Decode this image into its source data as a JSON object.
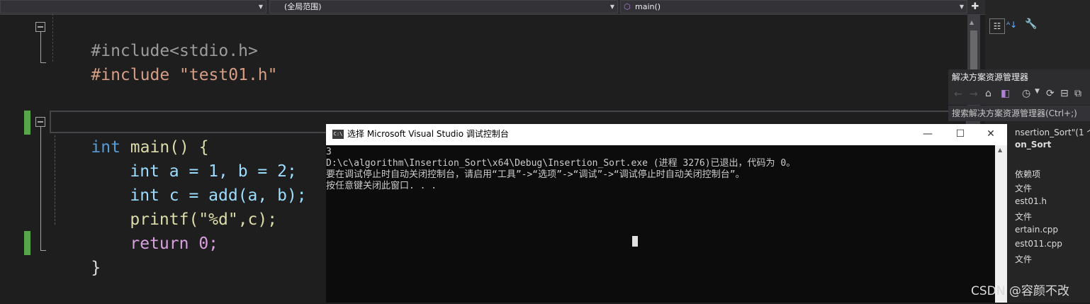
{
  "navbar": {
    "scope_dropdown": "(全局范围)",
    "member_dropdown": "main()"
  },
  "code": {
    "line1": "#include<stdio.h>",
    "line2": "#include \"test01.h\"",
    "line3_kw": "int",
    "line3_rest": " main() {",
    "line4": "int a = 1, b = 2;",
    "line5": "int c = add(a, b);",
    "line6": "printf(\"%d\",c);",
    "line7": "return 0;",
    "line8": "}"
  },
  "solution_explorer": {
    "title": "解决方案资源管理器",
    "search_placeholder": "搜索解决方案资源管理器(Ctrl+;)",
    "items": [
      "nsertion_Sort\"(1 个",
      "on_Sort",
      "依赖项",
      "文件",
      "est01.h",
      "文件",
      "ertain.cpp",
      "est011.cpp",
      "文件"
    ]
  },
  "console": {
    "title": "选择 Microsoft Visual Studio 调试控制台",
    "lines": [
      "3",
      "D:\\c\\algorithm\\Insertion_Sort\\x64\\Debug\\Insertion_Sort.exe (进程 3276)已退出，代码为 0。",
      "要在调试停止时自动关闭控制台，请启用“工具”->“选项”->“调试”->“调试停止时自动关闭控制台”。",
      "按任意键关闭此窗口. . ."
    ],
    "minimize": "—",
    "maximize": "☐",
    "close": "✕"
  },
  "watermark": "CSDN @容颜不改",
  "colors": {
    "editor_bg": "#1e1e1e",
    "keyword": "#569cd6",
    "function": "#dcdcaa",
    "string": "#d69d85",
    "variable": "#9cdcfe",
    "number": "#b5cea8",
    "control": "#d8a0df",
    "change_bar": "#57a64a"
  }
}
